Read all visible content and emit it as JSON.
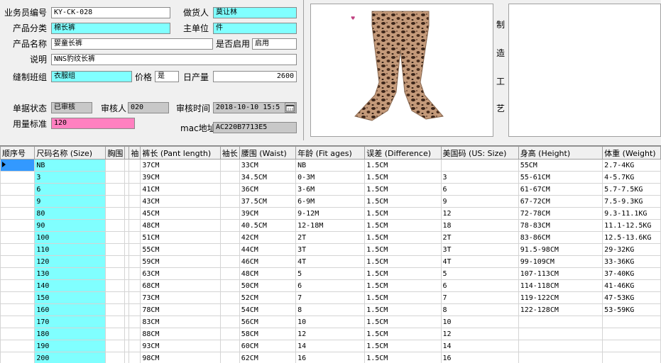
{
  "form": {
    "salesperson_code_label": "业务员编号",
    "salesperson_code": "KY-CK-028",
    "made_by_label": "做货人",
    "made_by": "莫让林",
    "category_label": "产品分类",
    "category": "棉长裤",
    "main_unit_label": "主单位",
    "main_unit": "件",
    "product_name_label": "产品名称",
    "product_name": "婴童长裤",
    "enabled_label": "是否启用",
    "enabled": "启用",
    "desc_label": "说明",
    "desc": "NNS豹纹长裤",
    "sewing_group_label": "缝制班组",
    "sewing_group": "衣服组",
    "price_label": "价格",
    "price": "是",
    "daily_output_label": "日产量",
    "daily_output": "2600",
    "status_label": "单据状态",
    "status": "已审核",
    "reviewer_label": "审核人",
    "reviewer": "020",
    "review_time_label": "审核时间",
    "review_time": "2018-10-10  15:5",
    "usage_label": "用量标准",
    "usage": "120",
    "mac_label": "mac地址",
    "mac": "AC220B7713E5"
  },
  "process_label": [
    "制",
    "造",
    "工",
    "艺"
  ],
  "grid": {
    "columns": [
      "顺序号",
      "尺码名称 (Size)",
      "胸围",
      "",
      "袖",
      "裤长 (Pant length)",
      "袖长",
      "腰围 (Waist)",
      "年龄 (Fit ages)",
      "误差 (Difference)",
      "美国码 (US: Size)",
      "身高 (Height)",
      "体重 (Weight)"
    ],
    "rows": [
      [
        "",
        "NB",
        "",
        "",
        "",
        "37CM",
        "",
        "33CM",
        "NB",
        "1.5CM",
        "",
        "55CM",
        "2.7-4KG"
      ],
      [
        "",
        "3",
        "",
        "",
        "",
        "39CM",
        "",
        "34.5CM",
        "0-3M",
        "1.5CM",
        "3",
        "55-61CM",
        "4-5.7KG"
      ],
      [
        "",
        "6",
        "",
        "",
        "",
        "41CM",
        "",
        "36CM",
        "3-6M",
        "1.5CM",
        "6",
        "61-67CM",
        "5.7-7.5KG"
      ],
      [
        "",
        "9",
        "",
        "",
        "",
        "43CM",
        "",
        "37.5CM",
        "6-9M",
        "1.5CM",
        "9",
        "67-72CM",
        "7.5-9.3KG"
      ],
      [
        "",
        "80",
        "",
        "",
        "",
        "45CM",
        "",
        "39CM",
        "9-12M",
        "1.5CM",
        "12",
        "72-78CM",
        "9.3-11.1KG"
      ],
      [
        "",
        "90",
        "",
        "",
        "",
        "48CM",
        "",
        "40.5CM",
        "12-18M",
        "1.5CM",
        "18",
        "78-83CM",
        "11.1-12.5KG"
      ],
      [
        "",
        "100",
        "",
        "",
        "",
        "51CM",
        "",
        "42CM",
        "2T",
        "1.5CM",
        "2T",
        "83-86CM",
        "12.5-13.6KG"
      ],
      [
        "",
        "110",
        "",
        "",
        "",
        "55CM",
        "",
        "44CM",
        "3T",
        "1.5CM",
        "3T",
        "91.5-98CM",
        "29-32KG"
      ],
      [
        "",
        "120",
        "",
        "",
        "",
        "59CM",
        "",
        "46CM",
        "4T",
        "1.5CM",
        "4T",
        "99-109CM",
        "33-36KG"
      ],
      [
        "",
        "130",
        "",
        "",
        "",
        "63CM",
        "",
        "48CM",
        "5",
        "1.5CM",
        "5",
        "107-113CM",
        "37-40KG"
      ],
      [
        "",
        "140",
        "",
        "",
        "",
        "68CM",
        "",
        "50CM",
        "6",
        "1.5CM",
        "6",
        "114-118CM",
        "41-46KG"
      ],
      [
        "",
        "150",
        "",
        "",
        "",
        "73CM",
        "",
        "52CM",
        "7",
        "1.5CM",
        "7",
        "119-122CM",
        "47-53KG"
      ],
      [
        "",
        "160",
        "",
        "",
        "",
        "78CM",
        "",
        "54CM",
        "8",
        "1.5CM",
        "8",
        "122-128CM",
        "53-59KG"
      ],
      [
        "",
        "170",
        "",
        "",
        "",
        "83CM",
        "",
        "56CM",
        "10",
        "1.5CM",
        "10",
        "",
        ""
      ],
      [
        "",
        "180",
        "",
        "",
        "",
        "88CM",
        "",
        "58CM",
        "12",
        "1.5CM",
        "12",
        "",
        ""
      ],
      [
        "",
        "190",
        "",
        "",
        "",
        "93CM",
        "",
        "60CM",
        "14",
        "1.5CM",
        "14",
        "",
        ""
      ],
      [
        "",
        "200",
        "",
        "",
        "",
        "98CM",
        "",
        "62CM",
        "16",
        "1.5CM",
        "16",
        "",
        ""
      ]
    ]
  },
  "icons": {
    "calendar": "calendar-icon",
    "row_pointer": "row-pointer-icon",
    "product_photo": "leopard-flare-pants-image"
  },
  "colors": {
    "cyan": "#80ffff",
    "pink": "#ff80c0",
    "selected": "#3399ff"
  }
}
